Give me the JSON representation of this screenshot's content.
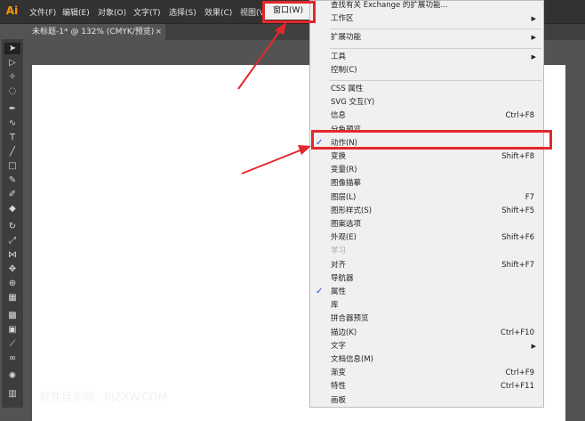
{
  "app": {
    "logo": "Ai"
  },
  "menubar": {
    "items": [
      "文件(F)",
      "编辑(E)",
      "对象(O)",
      "文字(T)",
      "选择(S)",
      "效果(C)",
      "视图(V)"
    ],
    "window_menu": "窗口(W)"
  },
  "document_tab": {
    "title": "未标题-1* @ 132% (CMYK/预览)",
    "close": "×"
  },
  "window_menu_items": [
    {
      "label": "查找有关 Exchange 的扩展功能...",
      "shortcut": "",
      "submenu": false,
      "checked": false,
      "disabled": false
    },
    {
      "label": "工作区",
      "shortcut": "",
      "submenu": true,
      "checked": false,
      "disabled": false
    },
    {
      "separator": true
    },
    {
      "label": "扩展功能",
      "shortcut": "",
      "submenu": true,
      "checked": false,
      "disabled": false
    },
    {
      "separator": true
    },
    {
      "label": "工具",
      "shortcut": "",
      "submenu": true,
      "checked": false,
      "disabled": false
    },
    {
      "label": "控制(C)",
      "shortcut": "",
      "submenu": false,
      "checked": false,
      "disabled": false
    },
    {
      "separator": true
    },
    {
      "label": "CSS 属性",
      "shortcut": "",
      "submenu": false,
      "checked": false,
      "disabled": false
    },
    {
      "label": "SVG 交互(Y)",
      "shortcut": "",
      "submenu": false,
      "checked": false,
      "disabled": false
    },
    {
      "label": "信息",
      "shortcut": "Ctrl+F8",
      "submenu": false,
      "checked": false,
      "disabled": false
    },
    {
      "label": "分色预览",
      "shortcut": "",
      "submenu": false,
      "checked": false,
      "disabled": false
    },
    {
      "label": "动作(N)",
      "shortcut": "",
      "submenu": false,
      "checked": true,
      "disabled": false
    },
    {
      "label": "变换",
      "shortcut": "Shift+F8",
      "submenu": false,
      "checked": false,
      "disabled": false
    },
    {
      "label": "变量(R)",
      "shortcut": "",
      "submenu": false,
      "checked": false,
      "disabled": false
    },
    {
      "label": "图像描摹",
      "shortcut": "",
      "submenu": false,
      "checked": false,
      "disabled": false
    },
    {
      "label": "图层(L)",
      "shortcut": "F7",
      "submenu": false,
      "checked": false,
      "disabled": false
    },
    {
      "label": "图形样式(S)",
      "shortcut": "Shift+F5",
      "submenu": false,
      "checked": false,
      "disabled": false
    },
    {
      "label": "图案选项",
      "shortcut": "",
      "submenu": false,
      "checked": false,
      "disabled": false
    },
    {
      "label": "外观(E)",
      "shortcut": "Shift+F6",
      "submenu": false,
      "checked": false,
      "disabled": false
    },
    {
      "label": "学习",
      "shortcut": "",
      "submenu": false,
      "checked": false,
      "disabled": true
    },
    {
      "label": "对齐",
      "shortcut": "Shift+F7",
      "submenu": false,
      "checked": false,
      "disabled": false
    },
    {
      "label": "导航器",
      "shortcut": "",
      "submenu": false,
      "checked": false,
      "disabled": false
    },
    {
      "label": "属性",
      "shortcut": "",
      "submenu": false,
      "checked": true,
      "disabled": false
    },
    {
      "label": "库",
      "shortcut": "",
      "submenu": false,
      "checked": false,
      "disabled": false
    },
    {
      "label": "拼合器预览",
      "shortcut": "",
      "submenu": false,
      "checked": false,
      "disabled": false
    },
    {
      "label": "描边(K)",
      "shortcut": "Ctrl+F10",
      "submenu": false,
      "checked": false,
      "disabled": false
    },
    {
      "label": "文字",
      "shortcut": "",
      "submenu": true,
      "checked": false,
      "disabled": false
    },
    {
      "label": "文档信息(M)",
      "shortcut": "",
      "submenu": false,
      "checked": false,
      "disabled": false
    },
    {
      "label": "渐变",
      "shortcut": "Ctrl+F9",
      "submenu": false,
      "checked": false,
      "disabled": false
    },
    {
      "label": "特性",
      "shortcut": "Ctrl+F11",
      "submenu": false,
      "checked": false,
      "disabled": false
    },
    {
      "label": "画板",
      "shortcut": "",
      "submenu": false,
      "checked": false,
      "disabled": false
    }
  ],
  "menu_glyphs": {
    "check": "✓",
    "submenu_arrow": "▶"
  },
  "tools": [
    "selection-tool-icon",
    "direct-selection-tool-icon",
    "magic-wand-tool-icon",
    "lasso-tool-icon",
    "pen-tool-icon",
    "curvature-tool-icon",
    "type-tool-icon",
    "line-tool-icon",
    "rectangle-tool-icon",
    "paintbrush-tool-icon",
    "shaper-tool-icon",
    "eraser-tool-icon",
    "rotate-tool-icon",
    "scale-tool-icon",
    "width-tool-icon",
    "free-transform-tool-icon",
    "shape-builder-tool-icon",
    "perspective-tool-icon",
    "mesh-tool-icon",
    "gradient-tool-icon",
    "eyedropper-tool-icon",
    "blend-tool-icon",
    "symbol-sprayer-tool-icon",
    "graph-tool-icon"
  ],
  "watermark": "软件自学网：RJZXW.COM",
  "colors": {
    "highlight": "#e3282c",
    "check": "#1a4ec8",
    "logo": "#ff9a00"
  }
}
